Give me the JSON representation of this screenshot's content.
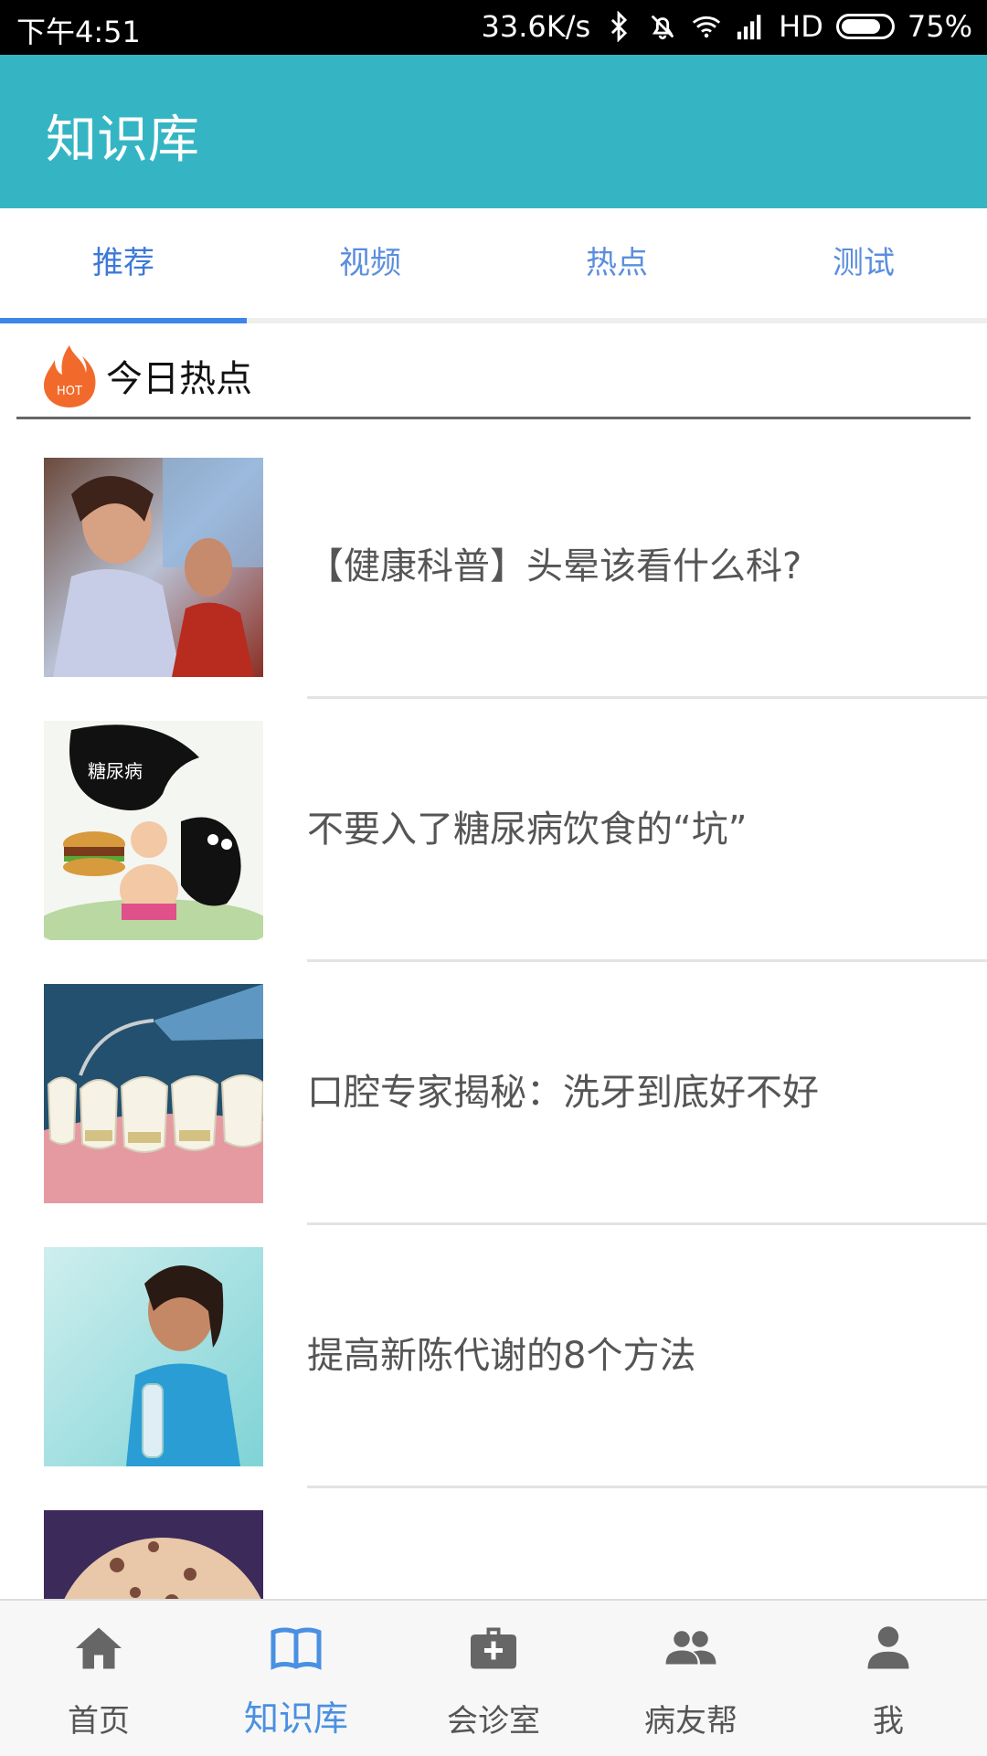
{
  "status_bar": {
    "time": "下午4:51",
    "net_speed": "33.6K/s",
    "network": "HD",
    "battery": "75%"
  },
  "app_bar": {
    "title": "知识库",
    "color": "#35b5c4"
  },
  "tabs": [
    {
      "label": "推荐",
      "active": true
    },
    {
      "label": "视频",
      "active": false
    },
    {
      "label": "热点",
      "active": false
    },
    {
      "label": "测试",
      "active": false
    }
  ],
  "section": {
    "title": "今日热点",
    "icon": "hot-flame-icon",
    "icon_text": "HOT"
  },
  "articles": [
    {
      "title": "【健康科普】头晕该看什么科?",
      "image": "dizzy-woman-image"
    },
    {
      "title": "不要入了糖尿病饮食的“坑”",
      "image": "diabetes-cartoon-image",
      "image_text": "糖尿病"
    },
    {
      "title": "口腔专家揭秘：洗牙到底好不好",
      "image": "teeth-cleaning-image"
    },
    {
      "title": "提高新陈代谢的8个方法",
      "image": "woman-water-bottle-image"
    },
    {
      "title": "",
      "image": "floral-pattern-image"
    }
  ],
  "bottom_nav": [
    {
      "label": "首页",
      "icon": "home-icon",
      "active": false
    },
    {
      "label": "知识库",
      "icon": "book-icon",
      "active": true
    },
    {
      "label": "会诊室",
      "icon": "medical-kit-icon",
      "active": false
    },
    {
      "label": "病友帮",
      "icon": "people-icon",
      "active": false
    },
    {
      "label": "我",
      "icon": "person-icon",
      "active": false
    }
  ]
}
